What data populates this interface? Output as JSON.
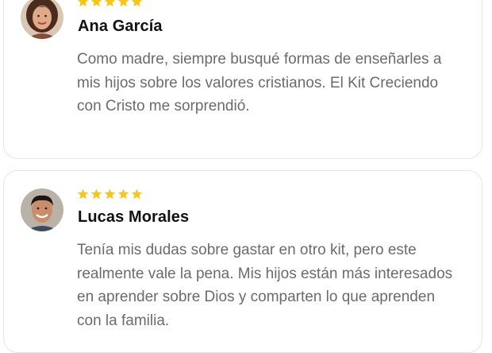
{
  "accent": {
    "star_color": "#f5c518",
    "text_muted": "#6b6b6b",
    "text_strong": "#111111"
  },
  "testimonials": [
    {
      "name": "Ana García",
      "rating": 5,
      "avatar_icon": "woman-avatar-icon",
      "text": "Como madre, siempre busqué formas de enseñarles a mis hijos sobre los valores cristianos. El Kit Creciendo con Cristo me sorprendió."
    },
    {
      "name": "Lucas Morales",
      "rating": 5,
      "avatar_icon": "man-avatar-icon",
      "text": "Tenía mis dudas sobre gastar en otro kit, pero este realmente vale la pena. Mis hijos están más interesados en aprender sobre Dios y comparten lo que aprenden con la familia."
    }
  ]
}
